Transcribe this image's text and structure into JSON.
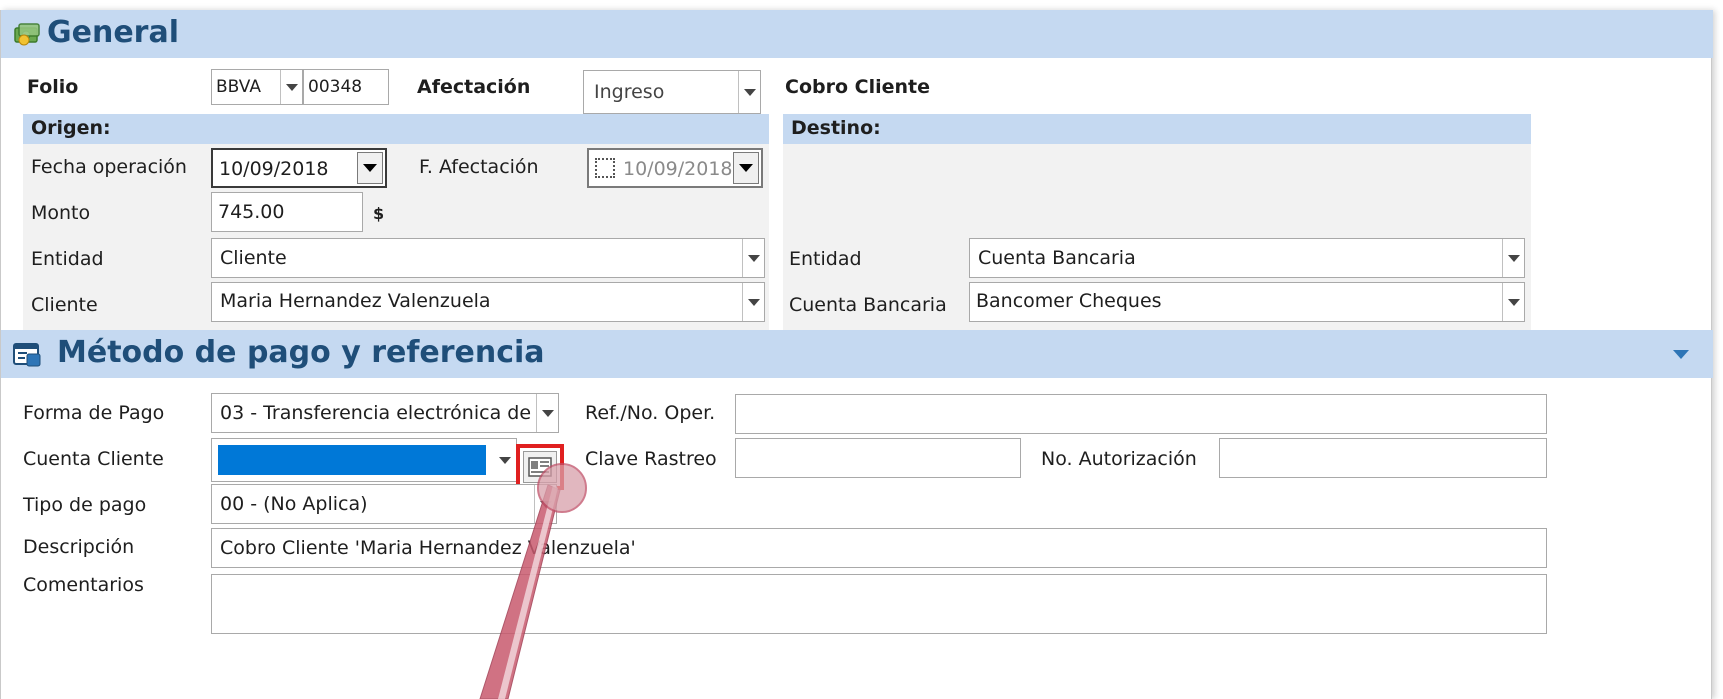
{
  "general": {
    "title": "General",
    "folio_label": "Folio",
    "folio_series": "BBVA",
    "folio_number": "00348",
    "afectacion_label": "Afectación",
    "afectacion_value": "Ingreso",
    "tipo_movimiento": "Cobro Cliente",
    "origen": {
      "header": "Origen:",
      "fecha_operacion_label": "Fecha operación",
      "fecha_operacion_value": "10/09/2018",
      "f_afectacion_label": "F. Afectación",
      "f_afectacion_value": "10/09/2018",
      "monto_label": "Monto",
      "monto_value": "745.00",
      "monto_currency": "$",
      "entidad_label": "Entidad",
      "entidad_value": "Cliente",
      "cliente_label": "Cliente",
      "cliente_value": "Maria Hernandez Valenzuela"
    },
    "destino": {
      "header": "Destino:",
      "entidad_label": "Entidad",
      "entidad_value": "Cuenta Bancaria",
      "cuenta_label": "Cuenta Bancaria",
      "cuenta_value": "Bancomer Cheques"
    }
  },
  "metodo": {
    "title": "Método de pago y referencia",
    "forma_pago_label": "Forma de Pago",
    "forma_pago_value": "03 - Transferencia electrónica de",
    "ref_label": "Ref./No. Oper.",
    "ref_value": "",
    "cuenta_cliente_label": "Cuenta Cliente",
    "cuenta_cliente_value": "",
    "clave_rastreo_label": "Clave Rastreo",
    "clave_rastreo_value": "",
    "no_autorizacion_label": "No. Autorización",
    "no_autorizacion_value": "",
    "tipo_pago_label": "Tipo de pago",
    "tipo_pago_value": "00 - (No Aplica)",
    "descripcion_label": "Descripción",
    "descripcion_value": "Cobro Cliente 'Maria Hernandez Valenzuela'",
    "comentarios_label": "Comentarios",
    "comentarios_value": ""
  },
  "colors": {
    "section_header_bg": "#c5d9f1",
    "section_title": "#1f4e79",
    "selected_field": "#0078d7",
    "highlight_box": "#e02020",
    "pointer": "#c85a6e"
  },
  "icons": {
    "general": "money-icon",
    "metodo": "payment-form-icon",
    "cuenta_lookup": "card-lookup-icon",
    "collapse": "collapse-arrow-icon"
  }
}
